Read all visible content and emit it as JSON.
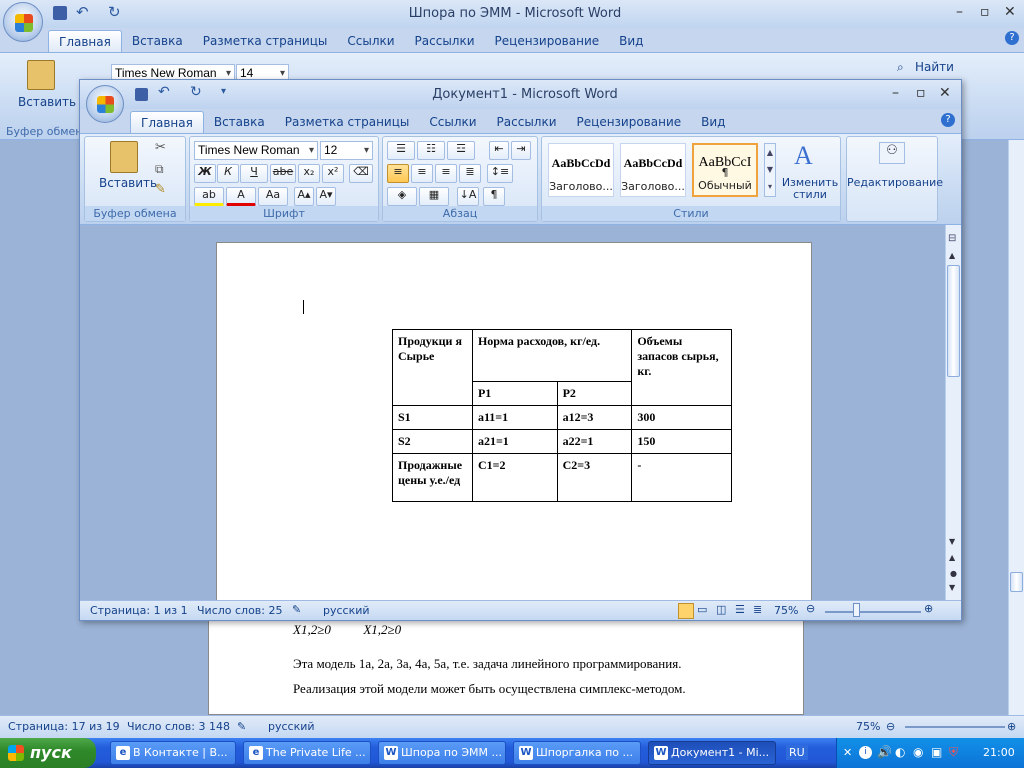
{
  "back_window": {
    "title": "Шпора по ЭММ - Microsoft Word",
    "tabs": [
      "Главная",
      "Вставка",
      "Разметка страницы",
      "Ссылки",
      "Рассылки",
      "Рецензирование",
      "Вид"
    ],
    "font_name": "Times New Roman",
    "font_size": "14",
    "paste_label": "Вставить",
    "clipboard_label": "Буфер обмена",
    "find_label": "Найти",
    "formula_text": "X1,2≥0          X1,2≥0",
    "body_line1": "Эта модель 1а, 2а, 3а, 4а, 5а, т.е. задача линейного программирования.",
    "body_line2": "Реализация этой модели может быть осуществлена симплекс-методом.",
    "status": {
      "page": "Страница: 17 из 19",
      "words": "Число слов: 3 148",
      "lang": "русский",
      "zoom": "75%"
    }
  },
  "front_window": {
    "title": "Документ1 - Microsoft Word",
    "tabs": [
      "Главная",
      "Вставка",
      "Разметка страницы",
      "Ссылки",
      "Рассылки",
      "Рецензирование",
      "Вид"
    ],
    "active_tab": "Главная",
    "ribbon": {
      "paste_label": "Вставить",
      "clipboard_label": "Буфер обмена",
      "font_name": "Times New Roman",
      "font_size": "12",
      "font_label": "Шрифт",
      "paragraph_label": "Абзац",
      "styles": [
        {
          "preview": "AaBbCcDd",
          "name": "Заголово..."
        },
        {
          "preview": "AaBbCcDd",
          "name": "Заголово..."
        },
        {
          "preview": "AaBbCcI",
          "name": "¶ Обычный"
        }
      ],
      "change_styles_label": "Изменить стили",
      "styles_label": "Стили",
      "editing_label": "Редактирование",
      "bold": "Ж",
      "italic": "К",
      "underline": "Ч",
      "strike": "abe",
      "sub": "x₂",
      "sup": "x²",
      "case": "Aa"
    },
    "table": {
      "r1c1": "Продукци я Сырье",
      "r1c2": "Норма расходов, кг/ед.",
      "r1c4": "Объемы запасов сырья, кг.",
      "p1": "P1",
      "p2": "P2",
      "rows": [
        [
          "S1",
          "a11=1",
          "a12=3",
          "300"
        ],
        [
          "S2",
          "a21=1",
          "a22=1",
          "150"
        ],
        [
          "Продажные цены у.е./ед",
          "C1=2",
          "C2=3",
          "-"
        ]
      ]
    },
    "status": {
      "page": "Страница: 1 из 1",
      "words": "Число слов: 25",
      "lang": "русский",
      "zoom": "75%"
    }
  },
  "taskbar": {
    "start": "пуск",
    "items": [
      {
        "label": "В Контакте | В...",
        "icon": "e"
      },
      {
        "label": "The Private Life ...",
        "icon": "e"
      },
      {
        "label": "Шпора по ЭММ ...",
        "icon": "W"
      },
      {
        "label": "Шпоргалка по ...",
        "icon": "W"
      },
      {
        "label": "Документ1 - Mi...",
        "icon": "W"
      }
    ],
    "lang": "RU",
    "clock": "21:00"
  }
}
